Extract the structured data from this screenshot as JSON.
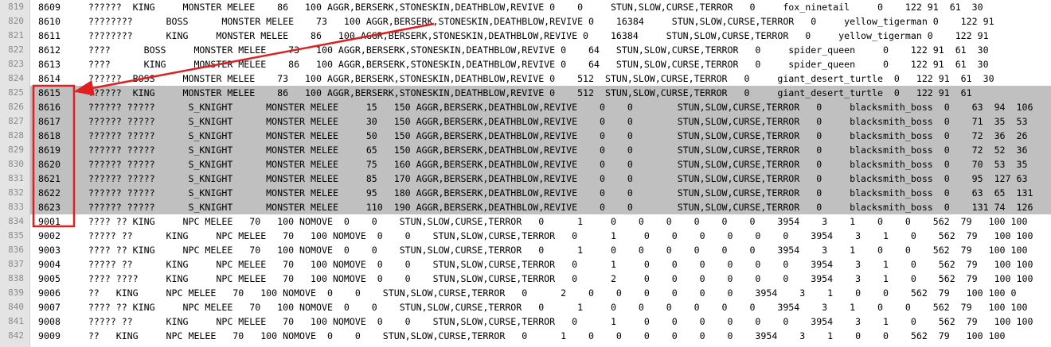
{
  "editor": {
    "first_line_number": 819,
    "selected_range": [
      825,
      833
    ],
    "lines": [
      "8609     ??????  KING     MONSTER MELEE    86   100 AGGR,BERSERK,STONESKIN,DEATHBLOW,REVIVE 0    0     STUN,SLOW,CURSE,TERROR   0     fox_ninetail     0    122 91  61  30",
      "8610     ????????      BOSS      MONSTER MELEE    73   100 AGGR,BERSERK,STONESKIN,DEATHBLOW,REVIVE 0    16384     STUN,SLOW,CURSE,TERROR   0     yellow_tigerman 0    122 91",
      "8611     ????????      KING     MONSTER MELEE    86   100 AGGR,BERSERK,STONESKIN,DEATHBLOW,REVIVE 0    16384     STUN,SLOW,CURSE,TERROR   0     yellow_tigerman 0    122 91",
      "8612     ????      BOSS     MONSTER MELEE    73   100 AGGR,BERSERK,STONESKIN,DEATHBLOW,REVIVE 0    64   STUN,SLOW,CURSE,TERROR   0     spider_queen     0    122 91  61  30",
      "8613     ????      KING     MONSTER MELEE    86   100 AGGR,BERSERK,STONESKIN,DEATHBLOW,REVIVE 0    64   STUN,SLOW,CURSE,TERROR   0     spider_queen     0    122 91  61  30",
      "8614     ??????  BOSS     MONSTER MELEE    73   100 AGGR,BERSERK,STONESKIN,DEATHBLOW,REVIVE 0    512  STUN,SLOW,CURSE,TERROR   0     giant_desert_turtle  0   122 91  61  30",
      "8615     ??????  KING     MONSTER MELEE    86   100 AGGR,BERSERK,STONESKIN,DEATHBLOW,REVIVE 0    512  STUN,SLOW,CURSE,TERROR   0     giant_desert_turtle  0   122 91  61",
      "8616     ?????? ?????      S_KNIGHT      MONSTER MELEE     15   150 AGGR,BERSERK,DEATHBLOW,REVIVE    0    0        STUN,SLOW,CURSE,TERROR   0     blacksmith_boss  0    63  94  106",
      "8617     ?????? ?????      S_KNIGHT      MONSTER MELEE     30   150 AGGR,BERSERK,DEATHBLOW,REVIVE    0    0        STUN,SLOW,CURSE,TERROR   0     blacksmith_boss  0    71  35  53",
      "8618     ?????? ?????      S_KNIGHT      MONSTER MELEE     50   150 AGGR,BERSERK,DEATHBLOW,REVIVE    0    0        STUN,SLOW,CURSE,TERROR   0     blacksmith_boss  0    72  36  26",
      "8619     ?????? ?????      S_KNIGHT      MONSTER MELEE     65   150 AGGR,BERSERK,DEATHBLOW,REVIVE    0    0        STUN,SLOW,CURSE,TERROR   0     blacksmith_boss  0    72  52  36",
      "8620     ?????? ?????      S_KNIGHT      MONSTER MELEE     75   160 AGGR,BERSERK,DEATHBLOW,REVIVE    0    0        STUN,SLOW,CURSE,TERROR   0     blacksmith_boss  0    70  53  35",
      "8621     ?????? ?????      S_KNIGHT      MONSTER MELEE     85   170 AGGR,BERSERK,DEATHBLOW,REVIVE    0    0        STUN,SLOW,CURSE,TERROR   0     blacksmith_boss  0    95  127 63",
      "8622     ?????? ?????      S_KNIGHT      MONSTER MELEE     95   180 AGGR,BERSERK,DEATHBLOW,REVIVE    0    0        STUN,SLOW,CURSE,TERROR   0     blacksmith_boss  0    63  65  131",
      "8623     ?????? ?????      S_KNIGHT      MONSTER MELEE     110  190 AGGR,BERSERK,DEATHBLOW,REVIVE    0    0        STUN,SLOW,CURSE,TERROR   0     blacksmith_boss  0    131 74  126",
      "9001     ???? ?? KING     NPC MELEE   70   100 NOMOVE  0    0    STUN,SLOW,CURSE,TERROR   0      1     0    0    0    0    0    0    3954    3    1    0    0    562  79   100 100",
      "9002     ????? ??      KING     NPC MELEE   70   100 NOMOVE  0    0    STUN,SLOW,CURSE,TERROR   0      1     0    0    0    0    0    0    3954    3    1    0    562  79   100 100",
      "9003     ???? ?? KING     NPC MELEE   70   100 NOMOVE  0    0    STUN,SLOW,CURSE,TERROR   0      1     0    0    0    0    0    0    3954    3    1    0    0    562  79   100 100",
      "9004     ????? ??      KING     NPC MELEE   70   100 NOMOVE  0    0    STUN,SLOW,CURSE,TERROR   0      1     0    0    0    0    0    0    3954    3    1    0    562  79   100 100",
      "9005     ???? ????     KING     NPC MELEE   70   100 NOMOVE  0    0    STUN,SLOW,CURSE,TERROR   0      2     0    0    0    0    0    0    3954    3    1    0    562  79   100 100",
      "9006     ??   KING     NPC MELEE   70   100 NOMOVE  0    0    STUN,SLOW,CURSE,TERROR   0      2    0    0    0    0    0    0    3954    3    1    0    0    562  79   100 100 0",
      "9007     ???? ?? KING     NPC MELEE   70   100 NOMOVE  0    0    STUN,SLOW,CURSE,TERROR   0      1     0    0    0    0    0    0    3954    3    1    0    0    562  79   100 100",
      "9008     ????? ??      KING     NPC MELEE   70   100 NOMOVE  0    0    STUN,SLOW,CURSE,TERROR   0      1     0    0    0    0    0    0    3954    3    1    0    562  79   100 100",
      "9009     ??   KING     NPC MELEE   70   100 NOMOVE  0    0    STUN,SLOW,CURSE,TERROR   0      1    0    0    0    0    0    0    3954    3    1    0    0    562  79   100 100"
    ]
  },
  "annotation": {
    "color": "#e02020"
  }
}
